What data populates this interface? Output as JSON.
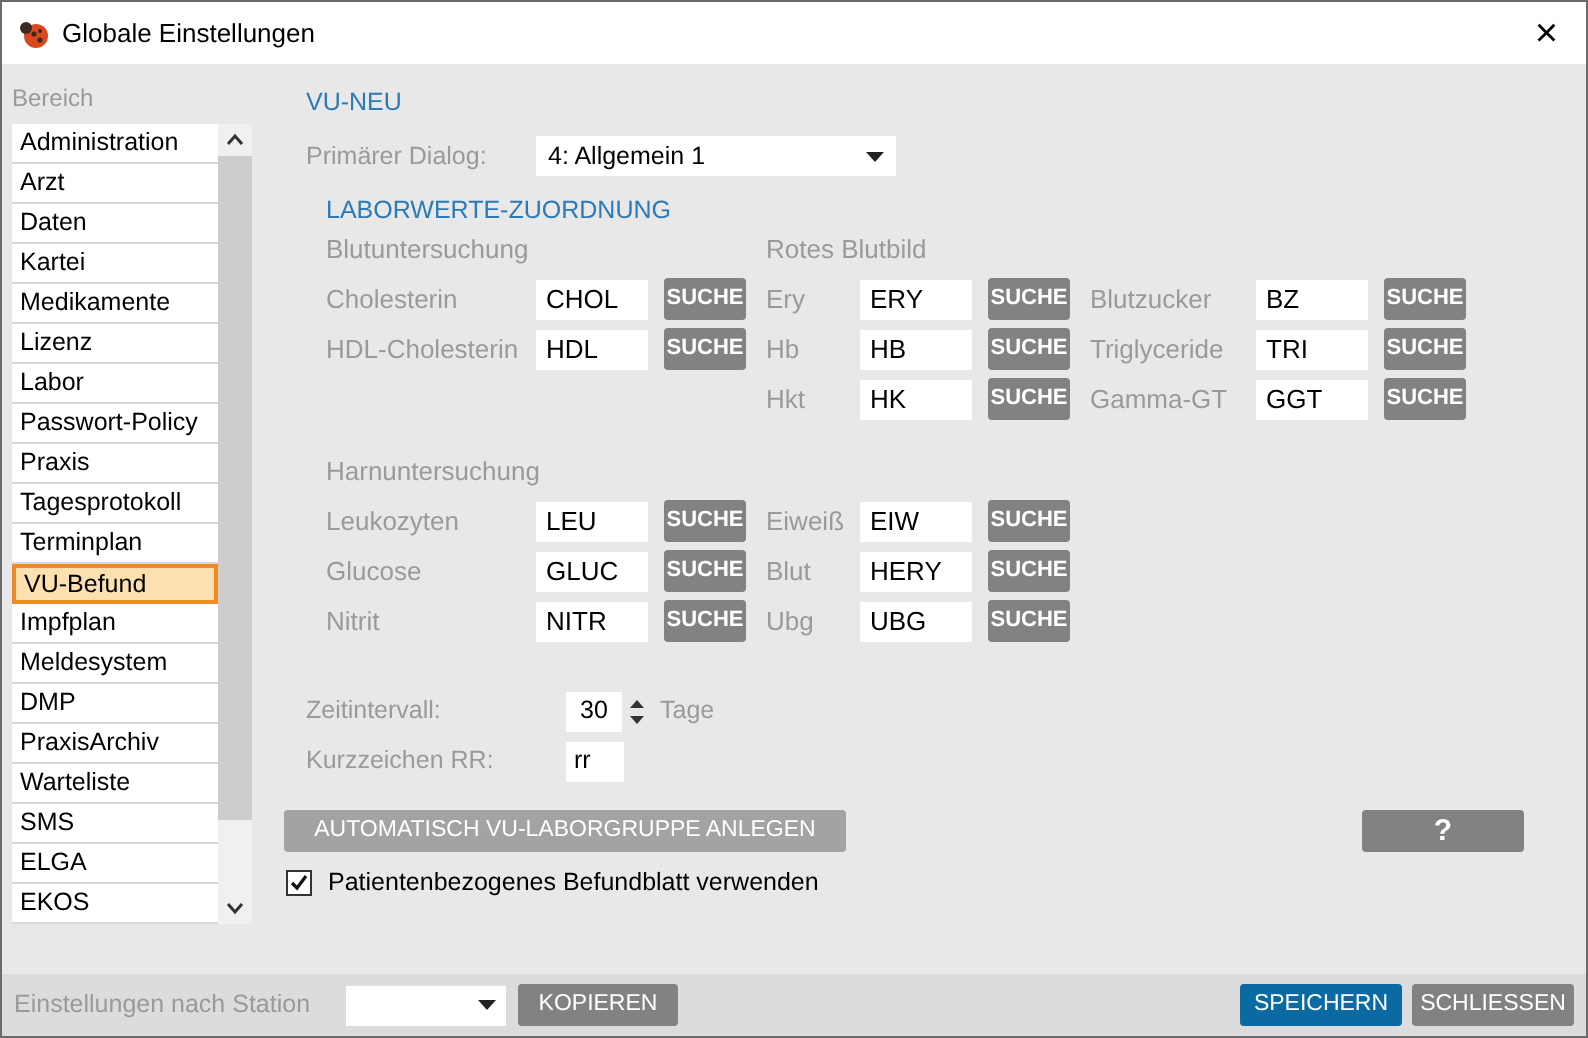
{
  "window": {
    "title": "Globale Einstellungen",
    "close": "×"
  },
  "sidebar": {
    "heading": "Bereich",
    "items": [
      {
        "label": "Administration",
        "selected": false
      },
      {
        "label": "Arzt",
        "selected": false
      },
      {
        "label": "Daten",
        "selected": false
      },
      {
        "label": "Kartei",
        "selected": false
      },
      {
        "label": "Medikamente",
        "selected": false
      },
      {
        "label": "Lizenz",
        "selected": false
      },
      {
        "label": "Labor",
        "selected": false
      },
      {
        "label": "Passwort-Policy",
        "selected": false
      },
      {
        "label": "Praxis",
        "selected": false
      },
      {
        "label": "Tagesprotokoll",
        "selected": false
      },
      {
        "label": "Terminplan",
        "selected": false
      },
      {
        "label": "VU-Befund",
        "selected": true
      },
      {
        "label": "Impfplan",
        "selected": false
      },
      {
        "label": "Meldesystem",
        "selected": false
      },
      {
        "label": "DMP",
        "selected": false
      },
      {
        "label": "PraxisArchiv",
        "selected": false
      },
      {
        "label": "Warteliste",
        "selected": false
      },
      {
        "label": "SMS",
        "selected": false
      },
      {
        "label": "ELGA",
        "selected": false
      },
      {
        "label": "EKOS",
        "selected": false
      }
    ]
  },
  "main": {
    "title": "VU-NEU",
    "primary_dialog": {
      "label": "Primärer Dialog:",
      "value": "4: Allgemein 1"
    },
    "lab_heading": "LABORWERTE-ZUORDNUNG",
    "sections": [
      {
        "columns": [
          {
            "heading": "Blutuntersuchung",
            "fields": [
              {
                "label": "Cholesterin",
                "value": "CHOL",
                "button": "SUCHE"
              },
              {
                "label": "HDL-Cholesterin",
                "value": "HDL",
                "button": "SUCHE"
              }
            ]
          },
          {
            "heading": "Rotes Blutbild",
            "fields": [
              {
                "label": "Ery",
                "value": "ERY",
                "button": "SUCHE"
              },
              {
                "label": "Hb",
                "value": "HB",
                "button": "SUCHE"
              },
              {
                "label": "Hkt",
                "value": "HK",
                "button": "SUCHE"
              }
            ]
          },
          {
            "fields": [
              {
                "label": "Blutzucker",
                "value": "BZ",
                "button": "SUCHE"
              },
              {
                "label": "Triglyceride",
                "value": "TRI",
                "button": "SUCHE"
              },
              {
                "label": "Gamma-GT",
                "value": "GGT",
                "button": "SUCHE"
              }
            ]
          }
        ]
      },
      {
        "columns": [
          {
            "heading": "Harnuntersuchung",
            "fields": [
              {
                "label": "Leukozyten",
                "value": "LEU",
                "button": "SUCHE"
              },
              {
                "label": "Glucose",
                "value": "GLUC",
                "button": "SUCHE"
              },
              {
                "label": "Nitrit",
                "value": "NITR",
                "button": "SUCHE"
              }
            ]
          },
          {
            "fields": [
              {
                "label": "Eiweiß",
                "value": "EIW",
                "button": "SUCHE"
              },
              {
                "label": "Blut",
                "value": "HERY",
                "button": "SUCHE"
              },
              {
                "label": "Ubg",
                "value": "UBG",
                "button": "SUCHE"
              }
            ]
          }
        ]
      }
    ],
    "interval": {
      "label": "Zeitintervall:",
      "value": "30",
      "unit": "Tage"
    },
    "short_code": {
      "label": "Kurzzeichen RR:",
      "value": "rr"
    },
    "auto_button": {
      "label": "AUTOMATISCH VU-LABORGRUPPE ANLEGEN",
      "disabled": true
    },
    "help_button": "?",
    "checkbox": {
      "label": "Patientenbezogenes Befundblatt verwenden",
      "checked": true
    }
  },
  "footer": {
    "station_label": "Einstellungen nach Station",
    "copy_button": "KOPIEREN",
    "save_button": "SPEICHERN",
    "close_button": "SCHLIESSEN"
  }
}
